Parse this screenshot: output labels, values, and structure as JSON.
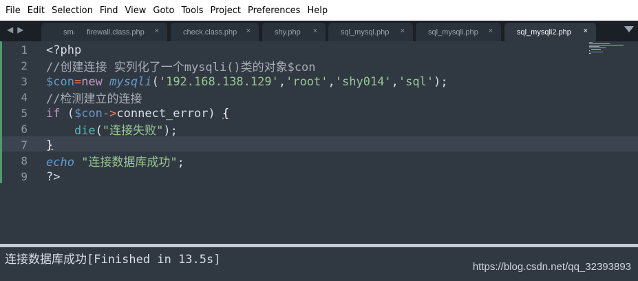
{
  "menu": [
    "File",
    "Edit",
    "Selection",
    "Find",
    "View",
    "Goto",
    "Tools",
    "Project",
    "Preferences",
    "Help"
  ],
  "tabs": [
    {
      "label": "sma",
      "active": false
    },
    {
      "label": "firewall.class.php",
      "active": false
    },
    {
      "label": "check.class.php",
      "active": false
    },
    {
      "label": "shy.php",
      "active": false
    },
    {
      "label": "sql_mysql.php",
      "active": false
    },
    {
      "label": "sql_mysqli.php",
      "active": false
    },
    {
      "label": "sql_mysqli2.php",
      "active": true
    }
  ],
  "close_glyph": "×",
  "nav_arrows": "◀▶",
  "line_numbers": [
    "1",
    "2",
    "3",
    "4",
    "5",
    "6",
    "7",
    "8",
    "9"
  ],
  "code": {
    "l1": "<?php",
    "l2": "//创建连接 实列化了一个mysqli()类的对象$con",
    "l3_var": "$con",
    "l3_eq": "=",
    "l3_new": "new",
    "l3_fn": "mysqli",
    "l3_open": "(",
    "l3_s1": "'192.168.138.129'",
    "l3_c1": ",",
    "l3_s2": "'root'",
    "l3_c2": ",",
    "l3_s3": "'shy014'",
    "l3_c3": ",",
    "l3_s4": "'sql'",
    "l3_close": ");",
    "l4": "//检测建立的连接",
    "l5_if": "if",
    "l5_open": " (",
    "l5_var": "$con",
    "l5_arrow": "->",
    "l5_prop": "connect_error) ",
    "l5_brace": "{",
    "l6_indent": "    ",
    "l6_die": "die",
    "l6_open": "(",
    "l6_str": "\"连接失败\"",
    "l6_close": ");",
    "l7": "}",
    "l8_echo": "echo",
    "l8_str": " \"连接数据库成功\"",
    "l8_semi": ";",
    "l9": "?>"
  },
  "output": "连接数据库成功[Finished in 13.5s]",
  "watermark": "https://blog.csdn.net/qq_32393893",
  "colors": {
    "background": "#303841",
    "tabbar": "#1b2026",
    "string": "#99c794",
    "comment": "#a7adba",
    "keyword": "#c594c5",
    "variable": "#6699cc",
    "operator": "#f97b58"
  }
}
